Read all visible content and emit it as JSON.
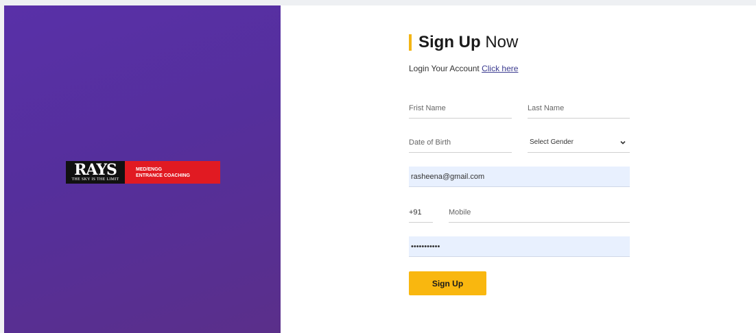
{
  "brand": {
    "logo_word": "RAYS",
    "logo_tagline": "THE SKY IS THE LIMIT",
    "logo_line1": "MED/ENGG",
    "logo_line2": "ENTRANCE COACHING"
  },
  "form": {
    "title_bold": "Sign Up",
    "title_rest": " Now",
    "login_prompt": "Login Your Account ",
    "login_link": "Click here",
    "first_name_placeholder": "Frist Name",
    "last_name_placeholder": "Last Name",
    "dob_placeholder": "Date of Birth",
    "gender_selected": "Select Gender",
    "email_value": "rasheena@gmail.com",
    "country_code": "+91",
    "mobile_placeholder": "Mobile",
    "password_value": "***********",
    "submit_label": "Sign Up"
  },
  "colors": {
    "panel_purple": "#5930a8",
    "accent_yellow": "#f9b70f",
    "logo_red": "#e11a22",
    "autofill_blue": "#e8f0fe"
  },
  "icons": {
    "gender_dropdown": "chevron-down-icon"
  }
}
